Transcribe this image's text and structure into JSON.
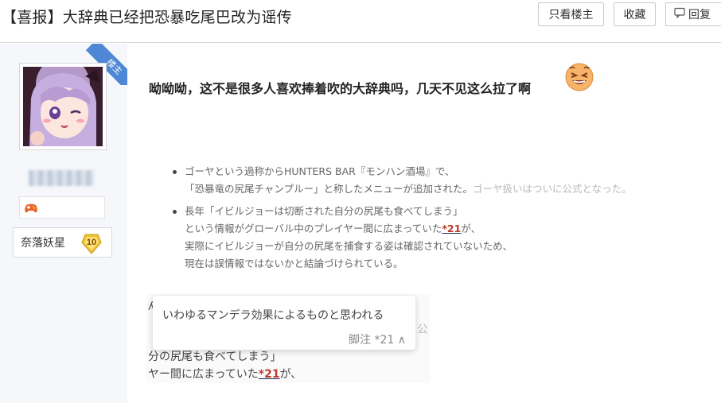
{
  "header": {
    "title": "【喜报】大辞典已经把恐暴吃尾巴改为谣传",
    "buttons": {
      "only_op": "只看楼主",
      "favorite": "收藏",
      "reply": "回复"
    }
  },
  "sidebar": {
    "ribbon": "楼主",
    "level_name": "奈落妖星",
    "level_number": "10"
  },
  "post": {
    "text": "呦呦呦，这不是很多人喜欢捧着吹的大辞典吗，几天不见这么拉了啊",
    "quote_items": [
      {
        "lines": [
          {
            "text": "ゴーヤという過称からHUNTERS BAR『モンハン酒場』で、",
            "faint": ""
          },
          {
            "text": "「恐暴竜の尻尾チャンプルー」と称したメニューが追加された。",
            "faint": "ゴーヤ扱いはついに公式となった。"
          }
        ]
      },
      {
        "lines": [
          {
            "text": "長年「イビルジョーは切断された自分の尻尾も食べてしまう」",
            "faint": ""
          },
          {
            "text": "という情報がグローバル中のプレイヤー間に広まっていた",
            "fn": "*21",
            "after": "が、"
          },
          {
            "text": "実際にイビルジョーが自分の尻尾を捕食する姿は確認されていないため、",
            "faint": ""
          },
          {
            "text": "現在は誤情報ではないかと結論づけられている。",
            "faint": ""
          }
        ]
      }
    ],
    "screenshot2": {
      "popup_text": "いわゆるマンデラ効果によるものと思われる",
      "popup_footnote": "脚注 *21 ∧",
      "edge_left": "ʎ",
      "edge_right": "公",
      "bg_line1": "分の尻尾も食べてしまう」",
      "bg_line2_pre": "ヤー間に広まっていた",
      "bg_line2_fn": "*21",
      "bg_line2_post": "が、"
    }
  },
  "colors": {
    "accent_ribbon": "#4e87d6",
    "footnote": "#c0392b",
    "sidebar_bg": "#f5f7fa"
  }
}
